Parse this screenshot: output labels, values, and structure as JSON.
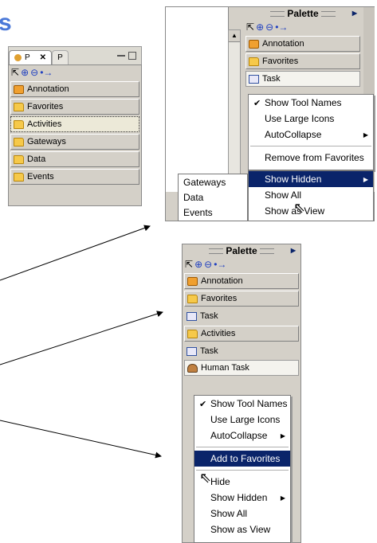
{
  "title_fragment": "s",
  "panel1": {
    "tabs": [
      {
        "label": "P"
      },
      {
        "label": "P"
      }
    ],
    "items": [
      {
        "label": "Annotation",
        "icon": "annotation-icon"
      },
      {
        "label": "Favorites",
        "icon": "folder-icon"
      },
      {
        "label": "Activities",
        "icon": "folder-icon"
      },
      {
        "label": "Gateways",
        "icon": "folder-icon"
      },
      {
        "label": "Data",
        "icon": "folder-icon"
      },
      {
        "label": "Events",
        "icon": "folder-icon"
      }
    ]
  },
  "panel2": {
    "header": "Palette",
    "items": [
      {
        "label": "Annotation"
      },
      {
        "label": "Favorites"
      },
      {
        "label": "Task"
      }
    ],
    "menu": [
      "Show Tool Names",
      "Use Large Icons",
      "AutoCollapse",
      "Remove from Favorites",
      "Show Hidden"
    ],
    "hidden_list": [
      "Gateways",
      "Data",
      "Events"
    ],
    "submenu": [
      "Show All",
      "Show as View"
    ]
  },
  "panel3": {
    "header": "Palette",
    "items": [
      {
        "label": "Annotation"
      },
      {
        "label": "Favorites"
      },
      {
        "label": "Task"
      },
      {
        "label": "Activities"
      },
      {
        "label": "Task"
      },
      {
        "label": "Human Task"
      }
    ],
    "menu": [
      "Show Tool Names",
      "Use Large Icons",
      "AutoCollapse",
      "Add to Favorites",
      "Hide",
      "Show Hidden",
      "Show All",
      "Show as View"
    ]
  },
  "colors": {
    "title": "#4a78d8",
    "highlight": "#0a246a",
    "frame": "#d4d0c8"
  }
}
